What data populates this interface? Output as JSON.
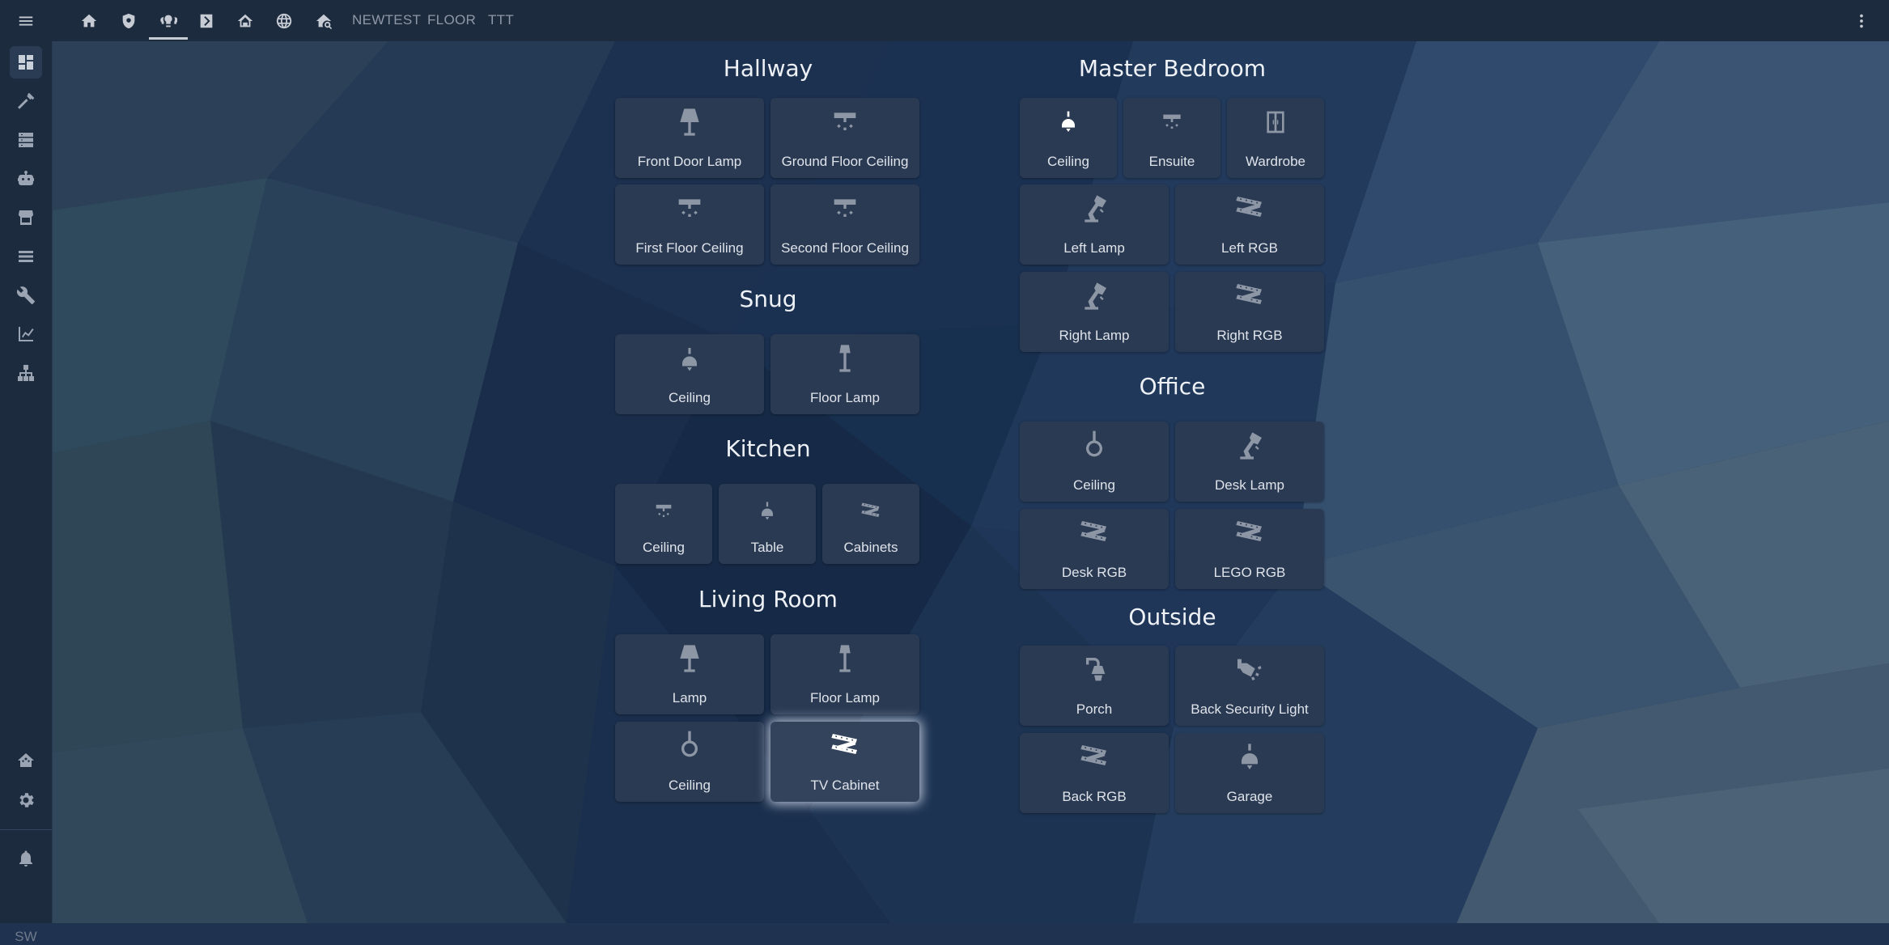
{
  "header": {
    "tabs": [
      {
        "icon": "home-icon"
      },
      {
        "icon": "shield-icon"
      },
      {
        "icon": "lightbulb-group-icon"
      },
      {
        "icon": "chevron-box-icon"
      },
      {
        "icon": "home-automation-icon"
      },
      {
        "icon": "web-icon"
      },
      {
        "icon": "home-search-icon"
      }
    ],
    "text_tabs": [
      "NEWTEST",
      "FLOOR",
      "TTT"
    ],
    "active_tab": 2
  },
  "sidebar": {
    "items": [
      "dashboard-icon",
      "hammer-icon",
      "server-icon",
      "robot-icon",
      "storefront-icon",
      "layers-icon",
      "wrench-icon",
      "chart-icon",
      "sitemap-icon"
    ],
    "bottom": [
      "home-assistant-icon",
      "cog-icon",
      "bell-icon"
    ],
    "user_initials": "SW"
  },
  "sections": {
    "hallway": {
      "title": "Hallway",
      "cards": [
        "Front Door Lamp",
        "Ground Floor Ceiling",
        "First Floor Ceiling",
        "Second Floor Ceiling"
      ]
    },
    "snug": {
      "title": "Snug",
      "cards": [
        "Ceiling",
        "Floor Lamp"
      ]
    },
    "kitchen": {
      "title": "Kitchen",
      "cards": [
        "Ceiling",
        "Table",
        "Cabinets"
      ]
    },
    "living_room": {
      "title": "Living Room",
      "cards": [
        "Lamp",
        "Floor Lamp",
        "Ceiling",
        "TV Cabinet"
      ]
    },
    "master_bedroom": {
      "title": "Master Bedroom",
      "cards": [
        "Ceiling",
        "Ensuite",
        "Wardrobe",
        "Left Lamp",
        "Left RGB",
        "Right Lamp",
        "Right RGB"
      ]
    },
    "office": {
      "title": "Office",
      "cards": [
        "Ceiling",
        "Desk Lamp",
        "Desk RGB",
        "LEGO RGB"
      ]
    },
    "outside": {
      "title": "Outside",
      "cards": [
        "Porch",
        "Back Security Light",
        "Back RGB",
        "Garage"
      ]
    }
  },
  "colors": {
    "topbar": "#1d2b3f",
    "card": "#2a3a53",
    "icon_off": "#8d96a5",
    "icon_on": "#ffffff",
    "background": "#1f3350"
  }
}
